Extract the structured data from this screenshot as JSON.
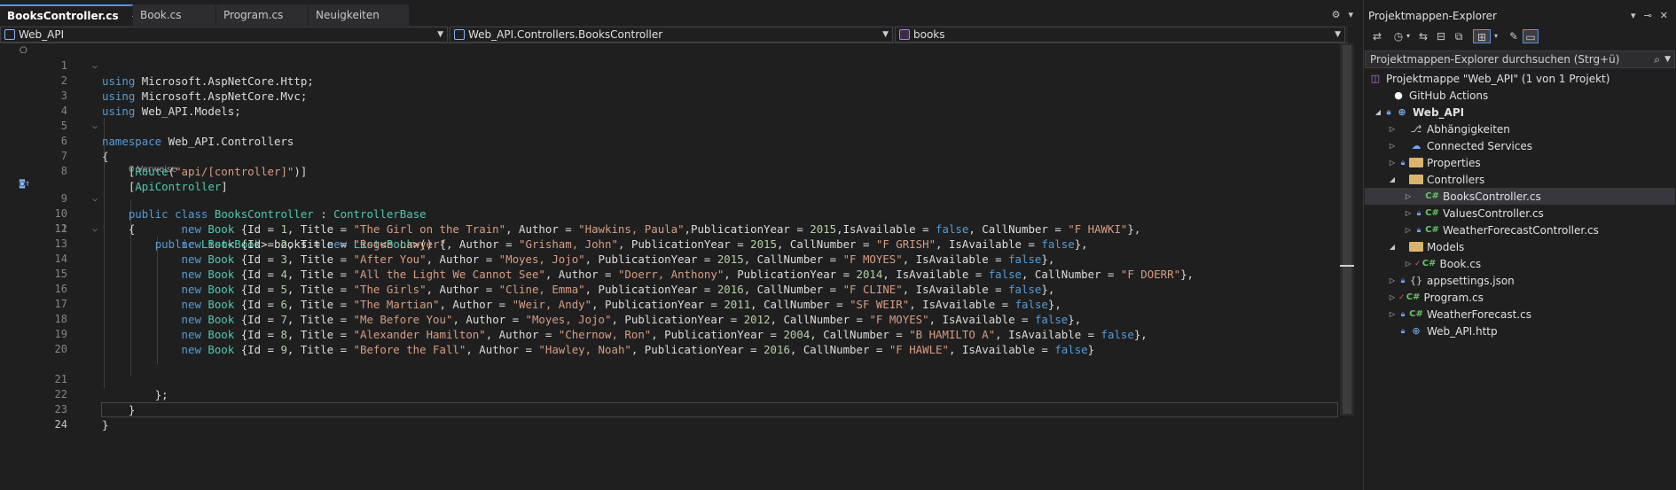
{
  "tabs": [
    {
      "label": "BooksController.cs",
      "active": true
    },
    {
      "label": "Book.cs",
      "active": false
    },
    {
      "label": "Program.cs",
      "active": false
    },
    {
      "label": "Neuigkeiten",
      "active": false
    }
  ],
  "navbar": {
    "project": "Web_API",
    "class": "Web_API.Controllers.BooksController",
    "member": "books"
  },
  "code": {
    "codelens_refs": "0 Verweise",
    "lines": [
      {
        "n": "1"
      },
      {
        "n": "2"
      },
      {
        "n": "3"
      },
      {
        "n": "4"
      },
      {
        "n": "5"
      },
      {
        "n": "6"
      },
      {
        "n": "7"
      },
      {
        "n": "8"
      },
      {
        "n": "9"
      },
      {
        "n": "10"
      },
      {
        "n": "11"
      },
      {
        "n": "12"
      },
      {
        "n": "13"
      },
      {
        "n": "14"
      },
      {
        "n": "15"
      },
      {
        "n": "16"
      },
      {
        "n": "17"
      },
      {
        "n": "18"
      },
      {
        "n": "19"
      },
      {
        "n": "20"
      },
      {
        "n": "21"
      },
      {
        "n": "22"
      },
      {
        "n": "23"
      },
      {
        "n": "24"
      }
    ],
    "text": {
      "using": "using",
      "ns1": "Microsoft.AspNetCore.Http;",
      "ns2": "Microsoft.AspNetCore.Mvc;",
      "ns3": "Web_API.Models;",
      "namespace": "namespace",
      "nsname": "Web_API.Controllers",
      "route_attr": "Route",
      "route_str": "\"api/[controller]\"",
      "apicontroller": "ApiController",
      "public": "public",
      "class": "class",
      "classname": "BooksController",
      "base": "ControllerBase",
      "list": "List",
      "book": "Book",
      "field": "books",
      "new": "new",
      "false": "false"
    },
    "books": [
      {
        "id": "1",
        "title": "\"The Girl on the Train\"",
        "author": "\"Hawkins, Paula\"",
        "year": "2015",
        "call": "\"F HAWKI\"",
        "order": "AYC"
      },
      {
        "id": "2",
        "title": "\"Rogue Lawyer\"",
        "author": "\"Grisham, John\"",
        "year": "2015",
        "call": "\"F GRISH\"",
        "order": "ACY"
      },
      {
        "id": "3",
        "title": "\"After You\"",
        "author": "\"Moyes, Jojo\"",
        "year": "2015",
        "call": "\"F MOYES\"",
        "order": "ACY"
      },
      {
        "id": "4",
        "title": "\"All the Light We Cannot See\"",
        "author": "\"Doerr, Anthony\"",
        "year": "2014",
        "call": "\"F DOERR\"",
        "order": "AYC"
      },
      {
        "id": "5",
        "title": "\"The Girls\"",
        "author": "\"Cline, Emma\"",
        "year": "2016",
        "call": "\"F CLINE\"",
        "order": "ACY"
      },
      {
        "id": "6",
        "title": "\"The Martian\"",
        "author": "\"Weir, Andy\"",
        "year": "2011",
        "call": "\"SF WEIR\"",
        "order": "ACY"
      },
      {
        "id": "7",
        "title": "\"Me Before You\"",
        "author": "\"Moyes, Jojo\"",
        "year": "2012",
        "call": "\"F MOYES\"",
        "order": "ACY"
      },
      {
        "id": "8",
        "title": "\"Alexander Hamilton\"",
        "author": "\"Chernow, Ron\"",
        "year": "2004",
        "call": "\"B HAMILTO A\"",
        "order": "ACY"
      },
      {
        "id": "9",
        "title": "\"Before the Fall\"",
        "author": "\"Hawley, Noah\"",
        "year": "2016",
        "call": "\"F HAWLE\"",
        "order": "ACY"
      }
    ]
  },
  "solution_explorer": {
    "title": "Projektmappen-Explorer",
    "search_placeholder": "Projektmappen-Explorer durchsuchen (Strg+ü)",
    "nodes": [
      {
        "label": "Projektmappe \"Web_API\" (1 von 1 Projekt)",
        "icon": "solution-icon"
      },
      {
        "label": "GitHub Actions",
        "icon": "github-icon"
      },
      {
        "label": "Web_API",
        "icon": "project-icon"
      },
      {
        "label": "Abhängigkeiten",
        "icon": "dependencies-icon"
      },
      {
        "label": "Connected Services",
        "icon": "connected-services-icon"
      },
      {
        "label": "Properties",
        "icon": "properties-icon"
      },
      {
        "label": "Controllers",
        "icon": "folder-icon"
      },
      {
        "label": "BooksController.cs",
        "icon": "csharp-file-icon"
      },
      {
        "label": "ValuesController.cs",
        "icon": "csharp-file-icon"
      },
      {
        "label": "WeatherForecastController.cs",
        "icon": "csharp-file-icon"
      },
      {
        "label": "Models",
        "icon": "folder-icon"
      },
      {
        "label": "Book.cs",
        "icon": "csharp-file-icon"
      },
      {
        "label": "appsettings.json",
        "icon": "json-file-icon"
      },
      {
        "label": "Program.cs",
        "icon": "csharp-file-icon"
      },
      {
        "label": "WeatherForecast.cs",
        "icon": "csharp-file-icon"
      },
      {
        "label": "Web_API.http",
        "icon": "http-file-icon"
      }
    ]
  },
  "colors": {
    "keyword": "#569cd6",
    "type": "#4ec9b0",
    "string": "#d69d85",
    "number": "#b5cea8",
    "accent": "#5b93e2"
  }
}
